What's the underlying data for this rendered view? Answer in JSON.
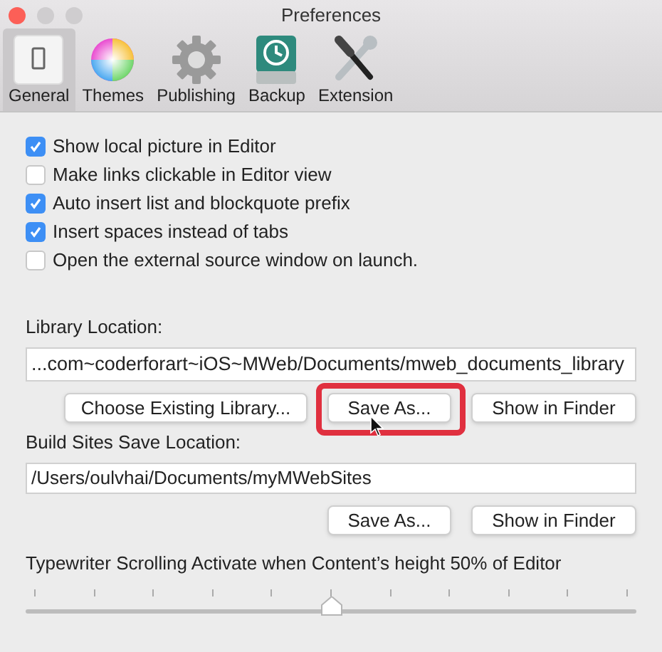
{
  "window": {
    "title": "Preferences"
  },
  "toolbar": [
    {
      "kind": "general",
      "label": "General",
      "selected": true
    },
    {
      "kind": "themes",
      "label": "Themes",
      "selected": false
    },
    {
      "kind": "publishing",
      "label": "Publishing",
      "selected": false
    },
    {
      "kind": "backup",
      "label": "Backup",
      "selected": false
    },
    {
      "kind": "extension",
      "label": "Extension",
      "selected": false
    }
  ],
  "options": [
    {
      "label": "Show local picture in Editor",
      "checked": true
    },
    {
      "label": "Make links clickable in Editor view",
      "checked": false
    },
    {
      "label": "Auto insert list and blockquote prefix",
      "checked": true
    },
    {
      "label": "Insert spaces instead of tabs",
      "checked": true
    },
    {
      "label": "Open the external source window on launch.",
      "checked": false
    }
  ],
  "library": {
    "label": "Library Location:",
    "value": "...com~coderforart~iOS~MWeb/Documents/mweb_documents_library",
    "buttons": [
      {
        "label": "Choose Existing Library...",
        "highlighted": false
      },
      {
        "label": "Save As...",
        "highlighted": true
      },
      {
        "label": "Show in Finder",
        "highlighted": false
      }
    ]
  },
  "build_sites": {
    "label": "Build Sites Save Location:",
    "value": "/Users/oulvhai/Documents/myMWebSites",
    "buttons": [
      {
        "label": "Save As...",
        "highlighted": false
      },
      {
        "label": "Show in Finder",
        "highlighted": false
      }
    ]
  },
  "typewriter": {
    "label": "Typewriter Scrolling Activate when Content’s height 50% of Editor",
    "level": 0.5
  }
}
